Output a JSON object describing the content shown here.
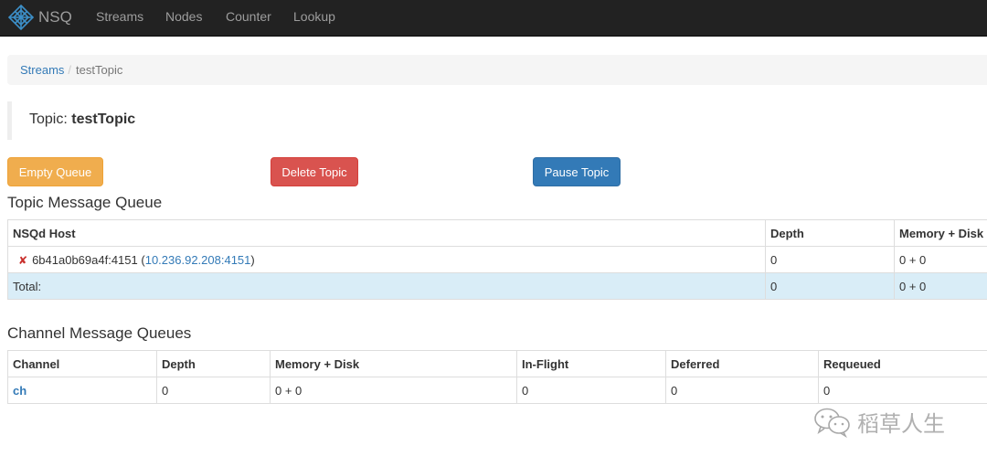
{
  "navbar": {
    "brand": "NSQ",
    "links": [
      "Streams",
      "Nodes",
      "Counter",
      "Lookup"
    ]
  },
  "breadcrumb": {
    "parent": "Streams",
    "separator": "/",
    "current": "testTopic"
  },
  "topic": {
    "label": "Topic:",
    "name": "testTopic"
  },
  "actions": {
    "empty_queue": "Empty Queue",
    "delete_topic": "Delete Topic",
    "pause_topic": "Pause Topic"
  },
  "topic_queue": {
    "title": "Topic Message Queue",
    "columns": [
      "NSQd Host",
      "Depth",
      "Memory + Disk"
    ],
    "rows": [
      {
        "status_icon": "x-mark-icon",
        "host": "6b41a0b69a4f:4151",
        "open_paren": "(",
        "address": "10.236.92.208:4151",
        "close_paren": ")",
        "depth": "0",
        "memory_disk": "0 + 0"
      }
    ],
    "total": {
      "label": "Total:",
      "depth": "0",
      "memory_disk": "0 + 0"
    }
  },
  "channel_queues": {
    "title": "Channel Message Queues",
    "columns": [
      "Channel",
      "Depth",
      "Memory + Disk",
      "In-Flight",
      "Deferred",
      "Requeued"
    ],
    "rows": [
      {
        "channel": "ch",
        "depth": "0",
        "memory_disk": "0 + 0",
        "in_flight": "0",
        "deferred": "0",
        "requeued": "0"
      }
    ]
  },
  "watermark": {
    "text": "稻草人生",
    "icon": "wechat-icon"
  },
  "colors": {
    "navbar_bg": "#222222",
    "link": "#337ab7",
    "warning": "#f0ad4e",
    "danger": "#d9534f",
    "primary": "#337ab7",
    "total_row": "#d9edf7"
  }
}
